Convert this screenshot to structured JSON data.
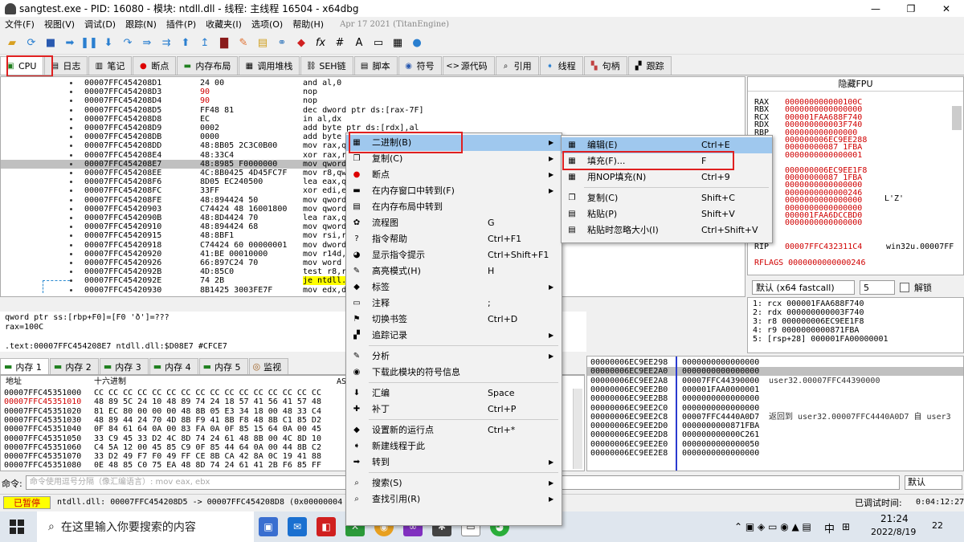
{
  "window": {
    "title": "sangtest.exe - PID: 16080 - 模块: ntdll.dll - 线程: 主线程 16504 - x64dbg"
  },
  "menubar": {
    "items": [
      "文件(F)",
      "视图(V)",
      "调试(D)",
      "跟踪(N)",
      "插件(P)",
      "收藏夹(I)",
      "选项(O)",
      "帮助(H)"
    ],
    "date": "Apr 17 2021 (TitanEngine)"
  },
  "tabs": [
    {
      "label": "CPU",
      "icon": "cpu-icon"
    },
    {
      "label": "日志",
      "icon": "log-icon"
    },
    {
      "label": "笔记",
      "icon": "notes-icon"
    },
    {
      "label": "断点",
      "icon": "breakpoint-icon"
    },
    {
      "label": "内存布局",
      "icon": "memory-map-icon"
    },
    {
      "label": "调用堆栈",
      "icon": "call-stack-icon"
    },
    {
      "label": "SEH链",
      "icon": "seh-icon"
    },
    {
      "label": "脚本",
      "icon": "script-icon"
    },
    {
      "label": "符号",
      "icon": "symbol-icon"
    },
    {
      "label": "源代码",
      "icon": "source-icon"
    },
    {
      "label": "引用",
      "icon": "references-icon"
    },
    {
      "label": "线程",
      "icon": "threads-icon"
    },
    {
      "label": "句柄",
      "icon": "handles-icon"
    },
    {
      "label": "跟踪",
      "icon": "trace-icon"
    }
  ],
  "disasm": [
    {
      "addr": "00007FFC454208D1",
      "bytes": "24 00",
      "ins": "and al,0"
    },
    {
      "addr": "00007FFC454208D3",
      "bytes": "90",
      "ins": "nop",
      "bred": true
    },
    {
      "addr": "00007FFC454208D4",
      "bytes": "90",
      "ins": "nop",
      "bred": true
    },
    {
      "addr": "00007FFC454208D5",
      "bytes": "FF48 81",
      "ins": "dec dword ptr ds:[rax-7F]"
    },
    {
      "addr": "00007FFC454208D8",
      "bytes": "EC",
      "ins": "in al,dx"
    },
    {
      "addr": "00007FFC454208D9",
      "bytes": "0002",
      "ins": "add byte ptr ds:[rdx],al"
    },
    {
      "addr": "00007FFC454208DB",
      "bytes": "0000",
      "ins": "add byte"
    },
    {
      "addr": "00007FFC454208DD",
      "bytes": "48:8B05 2C3C0B00",
      "ins": "mov rax,q"
    },
    {
      "addr": "00007FFC454208E4",
      "bytes": "48:33C4",
      "ins": "xor rax,r"
    },
    {
      "addr": "00007FFC454208E7",
      "bytes": "48:8985 F0000000",
      "ins": "mov qword",
      "sel": true
    },
    {
      "addr": "00007FFC454208EE",
      "bytes": "4C:8B0425 4D45FC7F",
      "ins": "mov r8,qw"
    },
    {
      "addr": "00007FFC454208F6",
      "bytes": "8D05 EC240500",
      "ins": "lea eax,q"
    },
    {
      "addr": "00007FFC454208FC",
      "bytes": "33FF",
      "ins": "xor edi,e"
    },
    {
      "addr": "00007FFC454208FE",
      "bytes": "48:894424 50",
      "ins": "mov qword"
    },
    {
      "addr": "00007FFC45420903",
      "bytes": "C74424 48 16001800",
      "ins": "mov qword"
    },
    {
      "addr": "00007FFC4542090B",
      "bytes": "48:8D4424 70",
      "ins": "lea rax,q"
    },
    {
      "addr": "00007FFC45420910",
      "bytes": "48:894424 68",
      "ins": "mov qword"
    },
    {
      "addr": "00007FFC45420915",
      "bytes": "48:8BF1",
      "ins": "mov rsi,r"
    },
    {
      "addr": "00007FFC45420918",
      "bytes": "C74424 60 00000001",
      "ins": "mov dword"
    },
    {
      "addr": "00007FFC45420920",
      "bytes": "41:BE 00010000",
      "ins": "mov r14d,"
    },
    {
      "addr": "00007FFC45420926",
      "bytes": "66:897C24 70",
      "ins": "mov word"
    },
    {
      "addr": "00007FFC4542092B",
      "bytes": "4D:85C0",
      "ins": "test r8,r"
    },
    {
      "addr": "00007FFC4542092E",
      "bytes": "74 2B",
      "ins": "je ntdll.",
      "hl": true
    },
    {
      "addr": "00007FFC45420930",
      "bytes": "8B1425 3003FE7F",
      "ins": "mov edx,d"
    }
  ],
  "registers": {
    "header": "隐藏FPU",
    "rows": [
      {
        "name": "RAX",
        "val": "000000000000100C"
      },
      {
        "name": "RBX",
        "val": "0000000000000000"
      },
      {
        "name": "RCX",
        "val": "000001FAA688F740"
      },
      {
        "name": "RDX",
        "val": "000000000003F740"
      },
      {
        "name": "RBP",
        "val": "000000000000000"
      },
      {
        "name": "",
        "val": "000000006EC9EE288"
      },
      {
        "name": "",
        "val": "00000000087 1FBA"
      },
      {
        "name": "",
        "val": "0000000000000001"
      },
      {
        "name": "",
        "val": ""
      },
      {
        "name": "",
        "val": "000000006EC9EE1F8"
      },
      {
        "name": "",
        "val": "00000000087 1FBA"
      },
      {
        "name": "",
        "val": "0000000000000000"
      },
      {
        "name": "",
        "val": "0000000000000246"
      },
      {
        "name": "",
        "val": "0000000000000000"
      },
      {
        "name": "",
        "val": "0000000000000000"
      },
      {
        "name": "",
        "val": "000001FAA6DCCBD0"
      },
      {
        "name": "",
        "val": "0000000000000000"
      }
    ],
    "rip_name": "RIP",
    "rip_val": "00007FFC432311C4",
    "rip_comment": "win32u.00007FF",
    "rflags": "RFLAGS  0000000000000246",
    "lz": "L'Z'"
  },
  "callconv": {
    "value": "默认 (x64 fastcall)",
    "count": "5",
    "unlock": "解锁"
  },
  "stackargs": [
    "1: rcx 000001FAA688F740",
    "2: rdx 000000000003F740",
    "3: r8 000000006EC9EE1F8",
    "4: r9 0000000000871FBA",
    "5: [rsp+28] 000001FA00000001"
  ],
  "info": [
    "qword ptr ss:[rbp+F0]=[F0 'ð']=???",
    "rax=100C",
    "",
    ".text:00007FFC454208E7 ntdll.dll:$D08E7 #CFCE7"
  ],
  "dumptabs": [
    "内存 1",
    "内存 2",
    "内存 3",
    "内存 4",
    "内存 5",
    "监视"
  ],
  "dump": {
    "head_addr": "地址",
    "head_hex": "十六进制",
    "head_ascii": "AS",
    "rows": [
      {
        "addr": "00007FFC45351000",
        "hex": "CC CC CC CC CC CC CC CC CC CC CC CC CC CC CC CC"
      },
      {
        "addr": "00007FFC45351010",
        "hex": "48 89 5C 24 10 48 89 74 24 18 57 41 56 41 57 48",
        "red": true
      },
      {
        "addr": "00007FFC45351020",
        "hex": "81 EC 80 00 00 00 48 8B 05 E3 34 18 00 48 33 C4"
      },
      {
        "addr": "00007FFC45351030",
        "hex": "48 89 44 24 70 4D 8B F9 41 8B F8 48 8B C1 85 D2"
      },
      {
        "addr": "00007FFC45351040",
        "hex": "0F 84 61 64 0A 00 83 FA 0A 0F 85 15 64 0A 00 45"
      },
      {
        "addr": "00007FFC45351050",
        "hex": "33 C9 45 33 D2 4C 8D 74 24 61 48 8B 00 4C 8D 10"
      },
      {
        "addr": "00007FFC45351060",
        "hex": "C4 5A 12 00 45 85 C9 0F 85 44 64 0A 00 44 8B C2"
      },
      {
        "addr": "00007FFC45351070",
        "hex": "33 D2 49 F7 F0 49 FF CE 8B CA 42 8A 0C 19 41 88"
      },
      {
        "addr": "00007FFC45351080",
        "hex": "0E 48 85 C0 75 EA 48 8D 74 24 61 41 2B F6 85 FF"
      }
    ]
  },
  "stack": [
    {
      "addr": "00000006EC9EE298",
      "val": "0000000000000000",
      "cmt": ""
    },
    {
      "addr": "00000006EC9EE2A0",
      "val": "0000000000000000",
      "cmt": "",
      "sel": true
    },
    {
      "addr": "00000006EC9EE2A8",
      "val": "00007FFC44390000",
      "cmt": "user32.00007FFC44390000"
    },
    {
      "addr": "00000006EC9EE2B0",
      "val": "000001FAA0000001",
      "cmt": ""
    },
    {
      "addr": "00000006EC9EE2B8",
      "val": "0000000000000000",
      "cmt": ""
    },
    {
      "addr": "00000006EC9EE2C0",
      "val": "0000000000000000",
      "cmt": ""
    },
    {
      "addr": "00000006EC9EE2C8",
      "val": "00007FFC4440A0D7",
      "cmt": "返回到 user32.00007FFC4440A0D7 自 user3"
    },
    {
      "addr": "00000006EC9EE2D0",
      "val": "0000000000871FBA",
      "cmt": ""
    },
    {
      "addr": "00000006EC9EE2D8",
      "val": "000000000000C261",
      "cmt": ""
    },
    {
      "addr": "00000006EC9EE2E0",
      "val": "0000000000000050",
      "cmt": ""
    },
    {
      "addr": "00000006EC9EE2E8",
      "val": "0000000000000000",
      "cmt": ""
    }
  ],
  "cmd": {
    "label": "命令:",
    "placeholder": "命令使用逗号分隔（像汇编语言）: mov eax, ebx",
    "dropdown": "默认"
  },
  "status": {
    "paused": "已暂停",
    "text": "ntdll.dll: 00007FFC454208D5 -> 00007FFC454208D8 (0x00000004 byte",
    "debug_time_label": "已调试时间:",
    "debug_time": "0:04:12:27"
  },
  "taskbar": {
    "search_placeholder": "在这里输入你要搜索的内容",
    "time": "21:24",
    "date": "2022/8/19",
    "ime": "中",
    "notif": "22"
  },
  "context_menu": [
    {
      "label": "二进制(B)",
      "icon": "binary-icon",
      "arrow": true,
      "hover": true
    },
    {
      "label": "复制(C)",
      "icon": "copy-icon",
      "arrow": true
    },
    {
      "label": "断点",
      "icon": "breakpoint-dot-icon",
      "arrow": true
    },
    {
      "label": "在内存窗口中转到(F)",
      "icon": "goto-dump-icon",
      "arrow": true
    },
    {
      "label": "在内存布局中转到",
      "icon": "goto-memmap-icon"
    },
    {
      "label": "流程图",
      "icon": "graph-icon",
      "sc": "G"
    },
    {
      "label": "指令帮助",
      "icon": "help-icon",
      "sc": "Ctrl+F1"
    },
    {
      "label": "显示指令提示",
      "icon": "hint-icon",
      "sc": "Ctrl+Shift+F1"
    },
    {
      "label": "高亮模式(H)",
      "icon": "highlight-icon",
      "sc": "H"
    },
    {
      "label": "标签",
      "icon": "label-icon",
      "arrow": true
    },
    {
      "label": "注释",
      "icon": "comment-icon",
      "sc": ";"
    },
    {
      "label": "切换书签",
      "icon": "bookmark-icon",
      "sc": "Ctrl+D"
    },
    {
      "label": "追踪记录",
      "icon": "trace-record-icon",
      "arrow": true
    },
    {
      "label": "分析",
      "icon": "analyze-icon",
      "arrow": true,
      "sep_before": true
    },
    {
      "label": "下载此模块的符号信息",
      "icon": "download-symbol-icon"
    },
    {
      "label": "汇编",
      "icon": "assemble-icon",
      "sc": "Space",
      "sep_before": true
    },
    {
      "label": "补丁",
      "icon": "patch-icon",
      "sc": "Ctrl+P"
    },
    {
      "label": "设置新的运行点",
      "icon": "set-ip-icon",
      "sc": "Ctrl+*",
      "sep_before": true
    },
    {
      "label": "新建线程于此",
      "icon": "new-thread-icon"
    },
    {
      "label": "转到",
      "icon": "goto-icon",
      "arrow": true
    },
    {
      "label": "搜索(S)",
      "icon": "search-icon",
      "arrow": true,
      "sep_before": true
    },
    {
      "label": "查找引用(R)",
      "icon": "find-ref-icon",
      "arrow": true
    }
  ],
  "submenu": [
    {
      "label": "编辑(E)",
      "icon": "edit-icon",
      "sc": "Ctrl+E",
      "hover": true
    },
    {
      "label": "填充(F)...",
      "icon": "fill-icon",
      "sc": "F"
    },
    {
      "label": "用NOP填充(N)",
      "icon": "fill-nop-icon",
      "sc": "Ctrl+9"
    },
    {
      "label": "复制(C)",
      "icon": "copy-icon",
      "sc": "Shift+C",
      "sep_before": true
    },
    {
      "label": "粘贴(P)",
      "icon": "paste-icon",
      "sc": "Shift+V"
    },
    {
      "label": "粘贴时忽略大小(I)",
      "icon": "paste-ignore-icon",
      "sc": "Ctrl+Shift+V"
    }
  ]
}
